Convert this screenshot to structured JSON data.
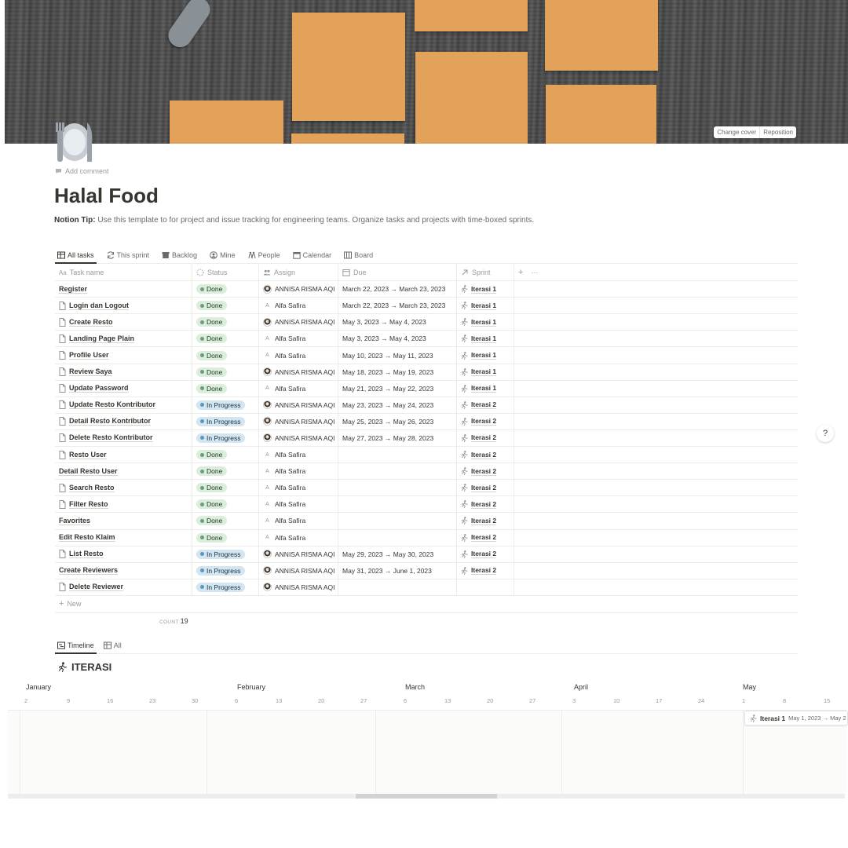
{
  "cover": {
    "change_label": "Change cover",
    "reposition_label": "Reposition"
  },
  "page": {
    "icon": "fork-knife-plate-icon",
    "add_comment": "Add comment",
    "title": "Halal Food",
    "tip_label": "Notion Tip:",
    "tip_text": " Use this template to for project and issue tracking for engineering teams. Organize tasks and projects with time-boxed sprints."
  },
  "views": [
    {
      "label": "All tasks",
      "icon": "table-icon"
    },
    {
      "label": "This sprint",
      "icon": "refresh-icon"
    },
    {
      "label": "Backlog",
      "icon": "archive-icon"
    },
    {
      "label": "Mine",
      "icon": "user-circle-icon"
    },
    {
      "label": "People",
      "icon": "people-icon"
    },
    {
      "label": "Calendar",
      "icon": "calendar-icon"
    },
    {
      "label": "Board",
      "icon": "board-icon"
    }
  ],
  "table": {
    "headers": {
      "name": "Task name",
      "name_prefix": "Aa",
      "status": "Status",
      "assign": "Assign",
      "due": "Due",
      "sprint": "Sprint",
      "add": "+",
      "more": "···"
    },
    "rows": [
      {
        "name": "Register",
        "doc": false,
        "status": "Done",
        "assign": "ANNISA RISMA AQI",
        "avatar": true,
        "due": "March 22, 2023 → March 23, 2023",
        "sprint": "Iterasi 1"
      },
      {
        "name": "Login dan Logout",
        "doc": true,
        "status": "Done",
        "assign": "Alfa Safira",
        "avatar": false,
        "due": "March 22, 2023 → March 23, 2023",
        "sprint": "Iterasi 1"
      },
      {
        "name": "Create Resto",
        "doc": true,
        "status": "Done",
        "assign": "ANNISA RISMA AQI",
        "avatar": true,
        "due": "May 3, 2023 → May 4, 2023",
        "sprint": "Iterasi 1"
      },
      {
        "name": "Landing Page Plain",
        "doc": true,
        "status": "Done",
        "assign": "Alfa Safira",
        "avatar": false,
        "due": "May 3, 2023 → May 4, 2023",
        "sprint": "Iterasi 1"
      },
      {
        "name": "Profile User",
        "doc": true,
        "status": "Done",
        "assign": "Alfa Safira",
        "avatar": false,
        "due": "May 10, 2023 → May 11, 2023",
        "sprint": "Iterasi 1"
      },
      {
        "name": "Review Saya",
        "doc": true,
        "status": "Done",
        "assign": "ANNISA RISMA AQI",
        "avatar": true,
        "due": "May 18, 2023 → May 19, 2023",
        "sprint": "Iterasi 1"
      },
      {
        "name": "Update Password",
        "doc": true,
        "status": "Done",
        "assign": "Alfa Safira",
        "avatar": false,
        "due": "May 21, 2023 → May 22, 2023",
        "sprint": "Iterasi 1"
      },
      {
        "name": "Update Resto Kontributor",
        "doc": true,
        "status": "In Progress",
        "assign": "ANNISA RISMA AQI",
        "avatar": true,
        "due": "May 23, 2023 → May 24, 2023",
        "sprint": "Iterasi 2"
      },
      {
        "name": "Detail Resto Kontributor",
        "doc": true,
        "status": "In Progress",
        "assign": "ANNISA RISMA AQI",
        "avatar": true,
        "due": "May 25, 2023 → May 26, 2023",
        "sprint": "Iterasi 2"
      },
      {
        "name": "Delete Resto Kontributor",
        "doc": true,
        "status": "In Progress",
        "assign": "ANNISA RISMA AQI",
        "avatar": true,
        "due": "May 27, 2023 → May 28, 2023",
        "sprint": "Iterasi 2"
      },
      {
        "name": "Resto User",
        "doc": true,
        "status": "Done",
        "assign": "Alfa Safira",
        "avatar": false,
        "due": "",
        "sprint": "Iterasi 2"
      },
      {
        "name": "Detail Resto User",
        "doc": false,
        "status": "Done",
        "assign": "Alfa Safira",
        "avatar": false,
        "due": "",
        "sprint": "Iterasi 2"
      },
      {
        "name": "Search Resto",
        "doc": true,
        "status": "Done",
        "assign": "Alfa Safira",
        "avatar": false,
        "due": "",
        "sprint": "Iterasi 2"
      },
      {
        "name": "Filter Resto",
        "doc": true,
        "status": "Done",
        "assign": "Alfa Safira",
        "avatar": false,
        "due": "",
        "sprint": "Iterasi 2"
      },
      {
        "name": "Favorites",
        "doc": false,
        "status": "Done",
        "assign": "Alfa Safira",
        "avatar": false,
        "due": "",
        "sprint": "Iterasi 2"
      },
      {
        "name": "Edit Resto Klaim",
        "doc": false,
        "status": "Done",
        "assign": "Alfa Safira",
        "avatar": false,
        "due": "",
        "sprint": "Iterasi 2"
      },
      {
        "name": "List Resto",
        "doc": true,
        "status": "In Progress",
        "assign": "ANNISA RISMA AQI",
        "avatar": true,
        "due": "May 29, 2023 → May 30, 2023",
        "sprint": "Iterasi 2"
      },
      {
        "name": "Create Reviewers",
        "doc": false,
        "status": "In Progress",
        "assign": "ANNISA RISMA AQI",
        "avatar": true,
        "due": "May 31, 2023 → June 1, 2023",
        "sprint": "Iterasi 2"
      },
      {
        "name": "Delete Reviewer",
        "doc": true,
        "status": "In Progress",
        "assign": "ANNISA RISMA AQI",
        "avatar": true,
        "due": "",
        "sprint": ""
      }
    ],
    "new_label": "New",
    "count_label": "COUNT",
    "count_value": "19"
  },
  "timeline": {
    "tabs": [
      {
        "label": "Timeline",
        "icon": "timeline-icon"
      },
      {
        "label": "All",
        "icon": "table-icon"
      }
    ],
    "title": "ITERASI",
    "months": [
      "January",
      "February",
      "March",
      "April",
      "May"
    ],
    "days": [
      "2",
      "9",
      "16",
      "23",
      "30",
      "6",
      "13",
      "20",
      "27",
      "6",
      "13",
      "20",
      "27",
      "3",
      "10",
      "17",
      "24",
      "1",
      "8",
      "15"
    ],
    "bar": {
      "name": "Iterasi 1",
      "dates": "May 1, 2023 → May 2"
    }
  },
  "help_label": "?",
  "colors": {
    "done_bg": "#dbeddb",
    "progress_bg": "#d3e5ef",
    "note": "#e3a25a"
  }
}
